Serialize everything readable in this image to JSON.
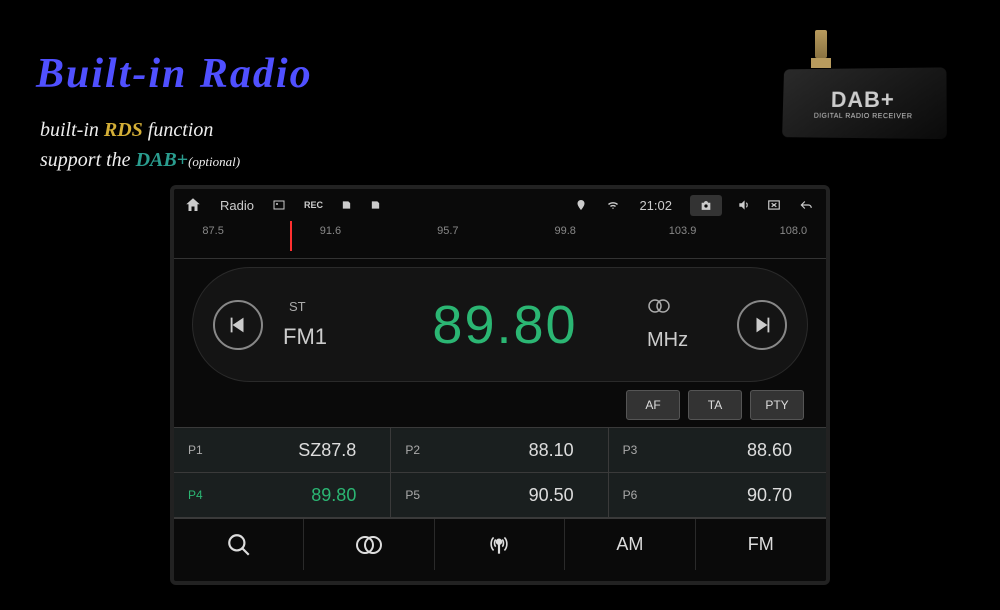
{
  "promo": {
    "title": "Built-in Radio",
    "line1_a": "built-in ",
    "line1_b": "RDS",
    "line1_c": " function",
    "line2_a": "support the ",
    "line2_b": "DAB+",
    "line2_c": "(optional)"
  },
  "device": {
    "brand": "DAB+",
    "sub": "DIGITAL RADIO RECEIVER"
  },
  "statusbar": {
    "app": "Radio",
    "time": "21:02"
  },
  "scale": {
    "ticks": [
      "87.5",
      "91.6",
      "95.7",
      "99.8",
      "103.9",
      "108.0"
    ]
  },
  "tuner": {
    "st": "ST",
    "band": "FM1",
    "frequency": "89.80",
    "unit": "MHz"
  },
  "options": [
    "AF",
    "TA",
    "PTY"
  ],
  "presets": [
    {
      "num": "P1",
      "val": "SZ87.8",
      "active": false
    },
    {
      "num": "P2",
      "val": "88.10",
      "active": false
    },
    {
      "num": "P3",
      "val": "88.60",
      "active": false
    },
    {
      "num": "P4",
      "val": "89.80",
      "active": true
    },
    {
      "num": "P5",
      "val": "90.50",
      "active": false
    },
    {
      "num": "P6",
      "val": "90.70",
      "active": false
    }
  ],
  "bottom": {
    "am": "AM",
    "fm": "FM"
  }
}
